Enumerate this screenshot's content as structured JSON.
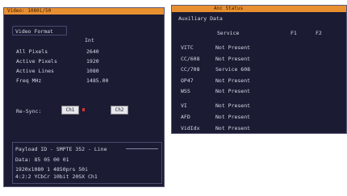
{
  "video_window": {
    "title": "Video: 1080i/50",
    "tab_label": "Video Format",
    "format_value": "Int",
    "fields": [
      {
        "label": "All Pixels",
        "value": "2640"
      },
      {
        "label": "Active Pixels",
        "value": "1920"
      },
      {
        "label": "Active Lines",
        "value": "1080"
      },
      {
        "label": "Freq MHz",
        "value": "1485.00"
      }
    ],
    "resync_label": "Re-Sync:",
    "resync_ch1": "Ch1",
    "resync_ch2": "Ch2",
    "payload": {
      "title": "Payload ID - SMPTE 352 - Line",
      "data": "Data: 85 05 00 01",
      "line1": "1920x1080 1 4850prs 50i",
      "line2": "4:2:2 YCbCr 10bit 20SX Ch1"
    }
  },
  "anc_window": {
    "title": "Anc Status",
    "section_label": "Auxiliary Data",
    "columns": {
      "service": "Service",
      "f1": "F1",
      "f2": "F2"
    },
    "rows": [
      {
        "name": "VITC",
        "status": "Not Present"
      },
      {
        "name": "CC/608",
        "status": "Not Present"
      },
      {
        "name": "CC/708",
        "status": "Service 608"
      },
      {
        "name": "OP47",
        "status": "Not Present"
      },
      {
        "name": "WSS",
        "status": "Not Present"
      },
      {
        "name": "VI",
        "status": "Not Present"
      },
      {
        "name": "AFD",
        "status": "Not Present"
      },
      {
        "name": "VidIdx",
        "status": "Not Present"
      }
    ]
  },
  "colors": {
    "panel_bg": "#1b1b33",
    "titlebar": "#e89030",
    "text": "#d8d8e8"
  }
}
